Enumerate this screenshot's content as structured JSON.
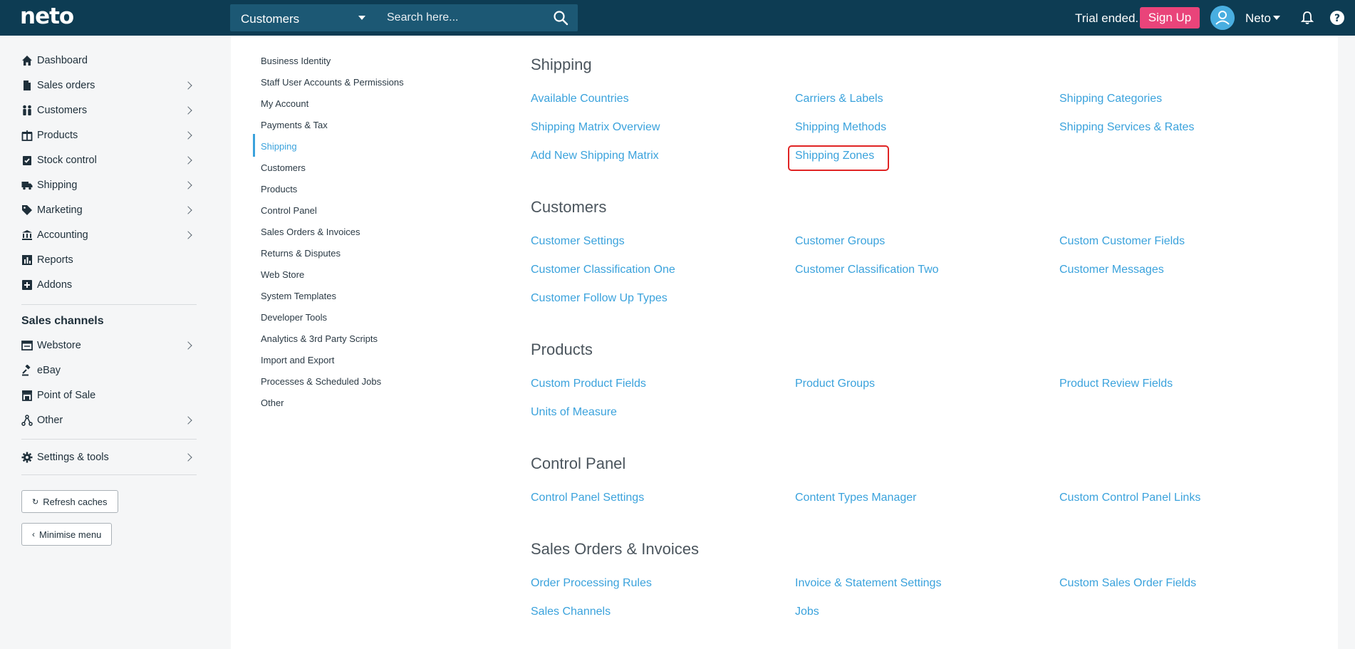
{
  "header": {
    "logo": "neto",
    "search_scope": "Customers",
    "search_placeholder": "Search here...",
    "trial_text": "Trial ended.",
    "signup_label": "Sign Up",
    "user_name": "Neto"
  },
  "sidebar": {
    "items": [
      {
        "label": "Dashboard",
        "icon": "home-icon"
      },
      {
        "label": "Sales orders",
        "icon": "document-icon"
      },
      {
        "label": "Customers",
        "icon": "people-icon"
      },
      {
        "label": "Products",
        "icon": "box-icon"
      },
      {
        "label": "Stock control",
        "icon": "clipboard-check-icon"
      },
      {
        "label": "Shipping",
        "icon": "truck-icon"
      },
      {
        "label": "Marketing",
        "icon": "tag-icon"
      },
      {
        "label": "Accounting",
        "icon": "bank-icon"
      },
      {
        "label": "Reports",
        "icon": "bar-chart-icon"
      },
      {
        "label": "Addons",
        "icon": "plus-square-icon"
      }
    ],
    "sales_channels_title": "Sales channels",
    "channels": [
      {
        "label": "Webstore",
        "icon": "browser-icon"
      },
      {
        "label": "eBay",
        "icon": "gavel-icon"
      },
      {
        "label": "Point of Sale",
        "icon": "store-icon"
      },
      {
        "label": "Other",
        "icon": "network-icon"
      }
    ],
    "settings_label": "Settings & tools",
    "refresh_label": "Refresh caches",
    "minimise_label": "Minimise menu"
  },
  "subnav": {
    "items": [
      "Business Identity",
      "Staff User Accounts & Permissions",
      "My Account",
      "Payments & Tax",
      "Shipping",
      "Customers",
      "Products",
      "Control Panel",
      "Sales Orders & Invoices",
      "Returns & Disputes",
      "Web Store",
      "System Templates",
      "Developer Tools",
      "Analytics & 3rd Party Scripts",
      "Import and Export",
      "Processes & Scheduled Jobs",
      "Other"
    ],
    "active": "Shipping"
  },
  "sections": {
    "shipping": {
      "title": "Shipping",
      "links": [
        "Available Countries",
        "Carriers & Labels",
        "Shipping Categories",
        "Shipping Matrix Overview",
        "Shipping Methods",
        "Shipping Services & Rates",
        "Add New Shipping Matrix",
        "Shipping Zones"
      ]
    },
    "customers": {
      "title": "Customers",
      "links": [
        "Customer Settings",
        "Customer Groups",
        "Custom Customer Fields",
        "Customer Classification One",
        "Customer Classification Two",
        "Customer Messages",
        "Customer Follow Up Types"
      ]
    },
    "products": {
      "title": "Products",
      "links": [
        "Custom Product Fields",
        "Product Groups",
        "Product Review Fields",
        "Units of Measure"
      ]
    },
    "control_panel": {
      "title": "Control Panel",
      "links": [
        "Control Panel Settings",
        "Content Types Manager",
        "Custom Control Panel Links"
      ]
    },
    "sales_orders": {
      "title": "Sales Orders & Invoices",
      "links": [
        "Order Processing Rules",
        "Invoice & Statement Settings",
        "Custom Sales Order Fields",
        "Sales Channels",
        "Jobs"
      ]
    }
  },
  "colors": {
    "topbar": "#0d3c53",
    "accent_link": "#3aa2dc",
    "signup": "#e9447a",
    "highlight_border": "#e02424"
  }
}
